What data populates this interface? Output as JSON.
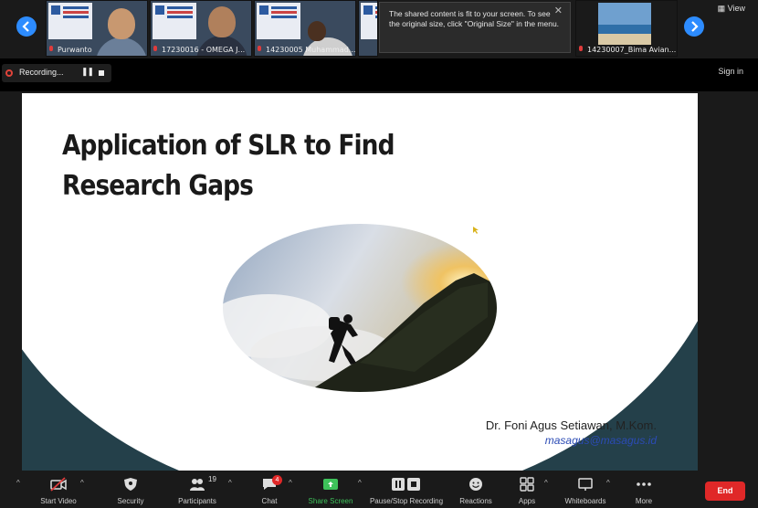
{
  "gallery": {
    "participants": [
      {
        "name": "Purwanto"
      },
      {
        "name": "17230016 - OMEGA J..."
      },
      {
        "name": "14230005 Muhammad..."
      },
      {
        "name": ""
      },
      {
        "name": "14230007_Bima Avian..."
      }
    ],
    "view_label": "View",
    "tooltip": "The shared content is fit to your screen. To see the original size, click \"Original Size\" in the menu."
  },
  "recording": {
    "label": "Recording...",
    "pause_glyph": "❚❚"
  },
  "header": {
    "signin_label": "Sign in"
  },
  "slide": {
    "title": "Application of SLR to Find Research Gaps",
    "author": "Dr. Foni Agus Setiawan, M.Kom.",
    "email": "masagus@masagus.id",
    "colors": {
      "background_dark": "#24404a",
      "email": "#2b4bb5"
    }
  },
  "toolbar": {
    "start_video": "Start Video",
    "security": "Security",
    "participants": "Participants",
    "participants_count": "19",
    "chat": "Chat",
    "chat_badge": "4",
    "share_screen": "Share Screen",
    "pause_recording": "Pause/Stop Recording",
    "reactions": "Reactions",
    "apps": "Apps",
    "whiteboards": "Whiteboards",
    "more": "More",
    "end": "End",
    "colors": {
      "share": "#3ec15a",
      "end": "#e02828"
    }
  }
}
